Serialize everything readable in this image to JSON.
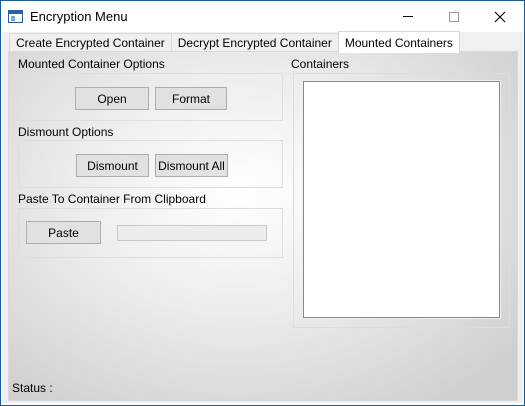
{
  "window": {
    "title": "Encryption Menu"
  },
  "tabs": [
    {
      "label": "Create Encrypted Container",
      "active": false
    },
    {
      "label": "Decrypt Encrypted Container",
      "active": false
    },
    {
      "label": "Mounted Containers",
      "active": true
    }
  ],
  "mounted_options": {
    "label": "Mounted Container Options",
    "open_label": "Open",
    "format_label": "Format"
  },
  "dismount_options": {
    "label": "Dismount Options",
    "dismount_label": "Dismount",
    "dismount_all_label": "Dismount All"
  },
  "paste_section": {
    "label": "Paste To Container From Clipboard",
    "paste_label": "Paste",
    "clipboard_value": ""
  },
  "containers": {
    "label": "Containers",
    "items": []
  },
  "status": {
    "label": "Status :",
    "value": ""
  },
  "icons": {
    "app": "app-window-icon",
    "minimize": "minimize-icon",
    "maximize": "maximize-icon",
    "close": "close-icon"
  }
}
